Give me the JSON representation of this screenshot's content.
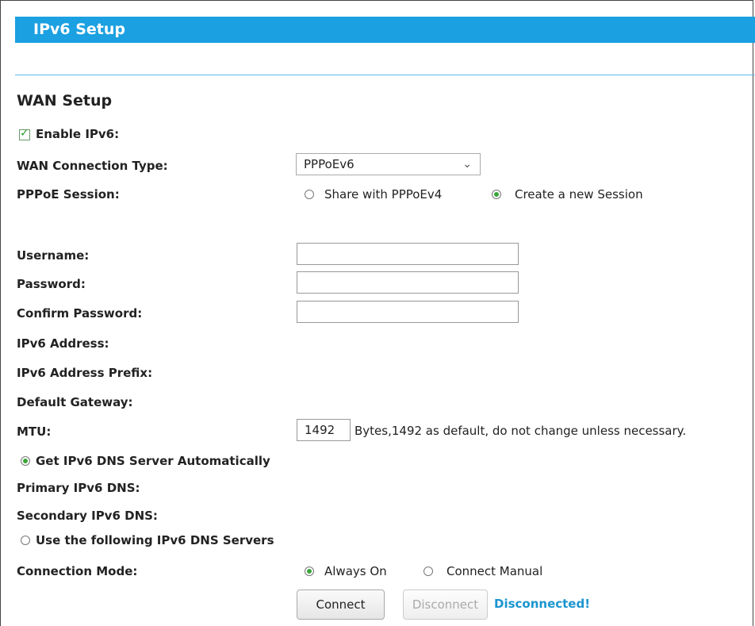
{
  "header": {
    "title": "IPv6 Setup"
  },
  "section": {
    "title": "WAN Setup"
  },
  "enable_ipv6": {
    "label": "Enable IPv6:",
    "checked": true
  },
  "wan_connection_type": {
    "label": "WAN Connection Type:",
    "value": "PPPoEv6"
  },
  "pppoe_session": {
    "label": "PPPoE Session:",
    "options": [
      {
        "label": "Share with PPPoEv4",
        "selected": false
      },
      {
        "label": "Create a new Session",
        "selected": true
      }
    ]
  },
  "fields": {
    "username": {
      "label": "Username:",
      "value": ""
    },
    "password": {
      "label": "Password:",
      "value": ""
    },
    "confirm_password": {
      "label": "Confirm Password:",
      "value": ""
    }
  },
  "info": {
    "ipv6_address": "IPv6 Address:",
    "ipv6_prefix": "IPv6 Address Prefix:",
    "default_gateway": "Default Gateway:"
  },
  "mtu": {
    "label": "MTU:",
    "value": "1492",
    "note": "Bytes,1492 as default, do not change unless necessary."
  },
  "dns": {
    "auto_label": "Get IPv6 DNS Server Automatically",
    "auto_selected": true,
    "primary_label": "Primary IPv6 DNS:",
    "secondary_label": "Secondary IPv6 DNS:",
    "manual_label": "Use the following IPv6 DNS Servers",
    "manual_selected": false
  },
  "connection_mode": {
    "label": "Connection Mode:",
    "options": [
      {
        "label": "Always On",
        "selected": true
      },
      {
        "label": "Connect Manual",
        "selected": false
      }
    ]
  },
  "buttons": {
    "connect": "Connect",
    "disconnect": "Disconnect"
  },
  "status": {
    "text": "Disconnected!",
    "color": "#1a95cf"
  },
  "colors": {
    "accent": "#1ba0e1"
  }
}
